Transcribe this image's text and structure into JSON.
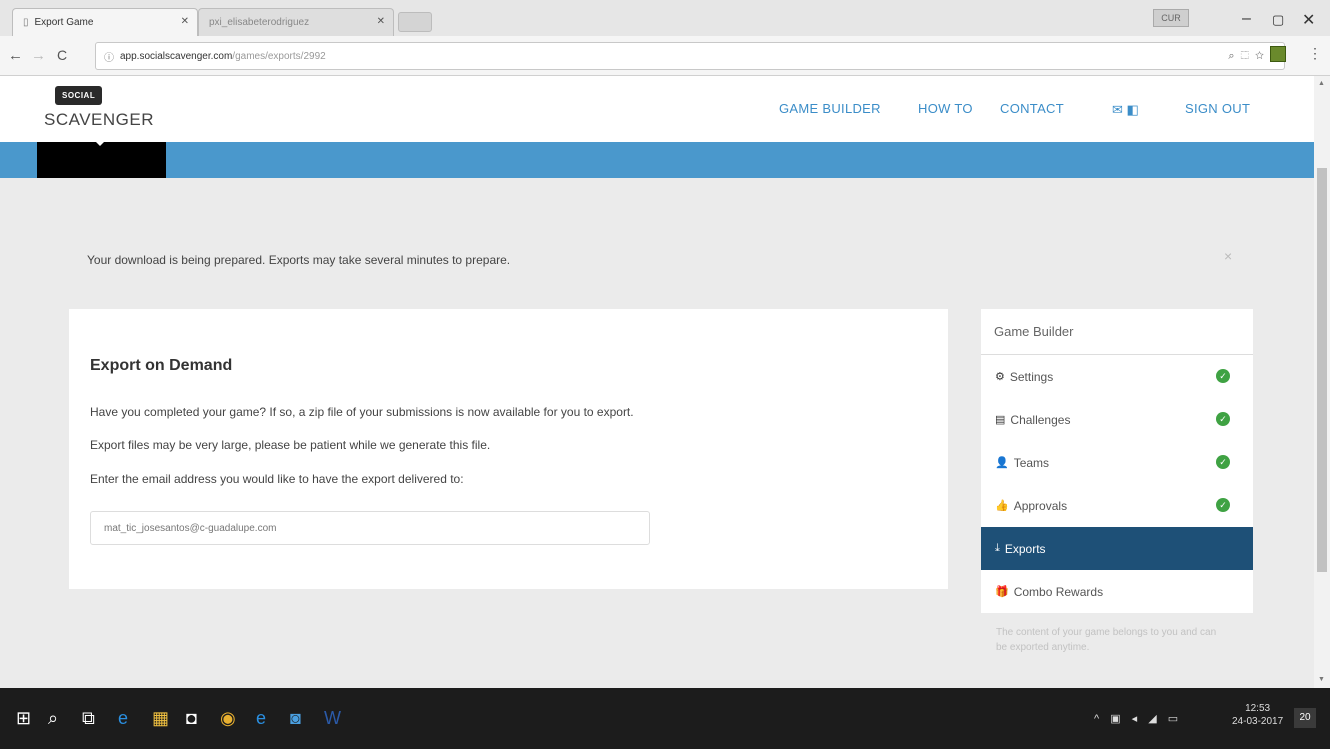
{
  "browser": {
    "tabs": [
      {
        "label": "Export Game",
        "active": true
      },
      {
        "label": "pxi_elisabeterodriguez",
        "active": false
      }
    ],
    "user_badge": "CUR",
    "url_domain": "app.socialscavenger.com",
    "url_path": "/games/exports/2992"
  },
  "header": {
    "logo_badge": "SOCIAL",
    "logo_text": "SCAVENGER",
    "nav": {
      "game_builder": "GAME BUILDER",
      "how_to": "HOW TO",
      "contact": "CONTACT",
      "sign_out": "SIGN OUT"
    }
  },
  "notice": {
    "text": "Your download is being prepared. Exports may take several minutes to prepare.",
    "close": "×"
  },
  "export_panel": {
    "title": "Export on Demand",
    "line1": "Have you completed your game? If so, a zip file of your submissions is now available for you to export.",
    "line2": "Export files may be very large, please be patient while we generate this file.",
    "line3": "Enter the email address you would like to have the export delivered to:",
    "email_value": "mat_tic_josesantos@c-guadalupe.com"
  },
  "sidebar": {
    "heading": "Game Builder",
    "items": [
      {
        "label": "Settings",
        "icon": "gear-icon",
        "glyph": "⚙",
        "checked": true
      },
      {
        "label": "Challenges",
        "icon": "list-icon",
        "glyph": "▤",
        "checked": true
      },
      {
        "label": "Teams",
        "icon": "person-icon",
        "glyph": "👤",
        "checked": true
      },
      {
        "label": "Approvals",
        "icon": "thumbs-up-icon",
        "glyph": "👍",
        "checked": true
      },
      {
        "label": "Exports",
        "icon": "download-icon",
        "glyph": "⤓",
        "checked": false,
        "active": true
      },
      {
        "label": "Combo Rewards",
        "icon": "gift-icon",
        "glyph": "🎁",
        "checked": false
      }
    ],
    "note": "The content of your game belongs to you and can be exported anytime."
  },
  "taskbar": {
    "time": "12:53",
    "date": "24-03-2017",
    "notification_count": "20"
  },
  "colors": {
    "accent_blue": "#4a98cc",
    "nav_blue": "#3b8dc8",
    "active_sidebar": "#1e5077",
    "check_green": "#3fa243"
  }
}
